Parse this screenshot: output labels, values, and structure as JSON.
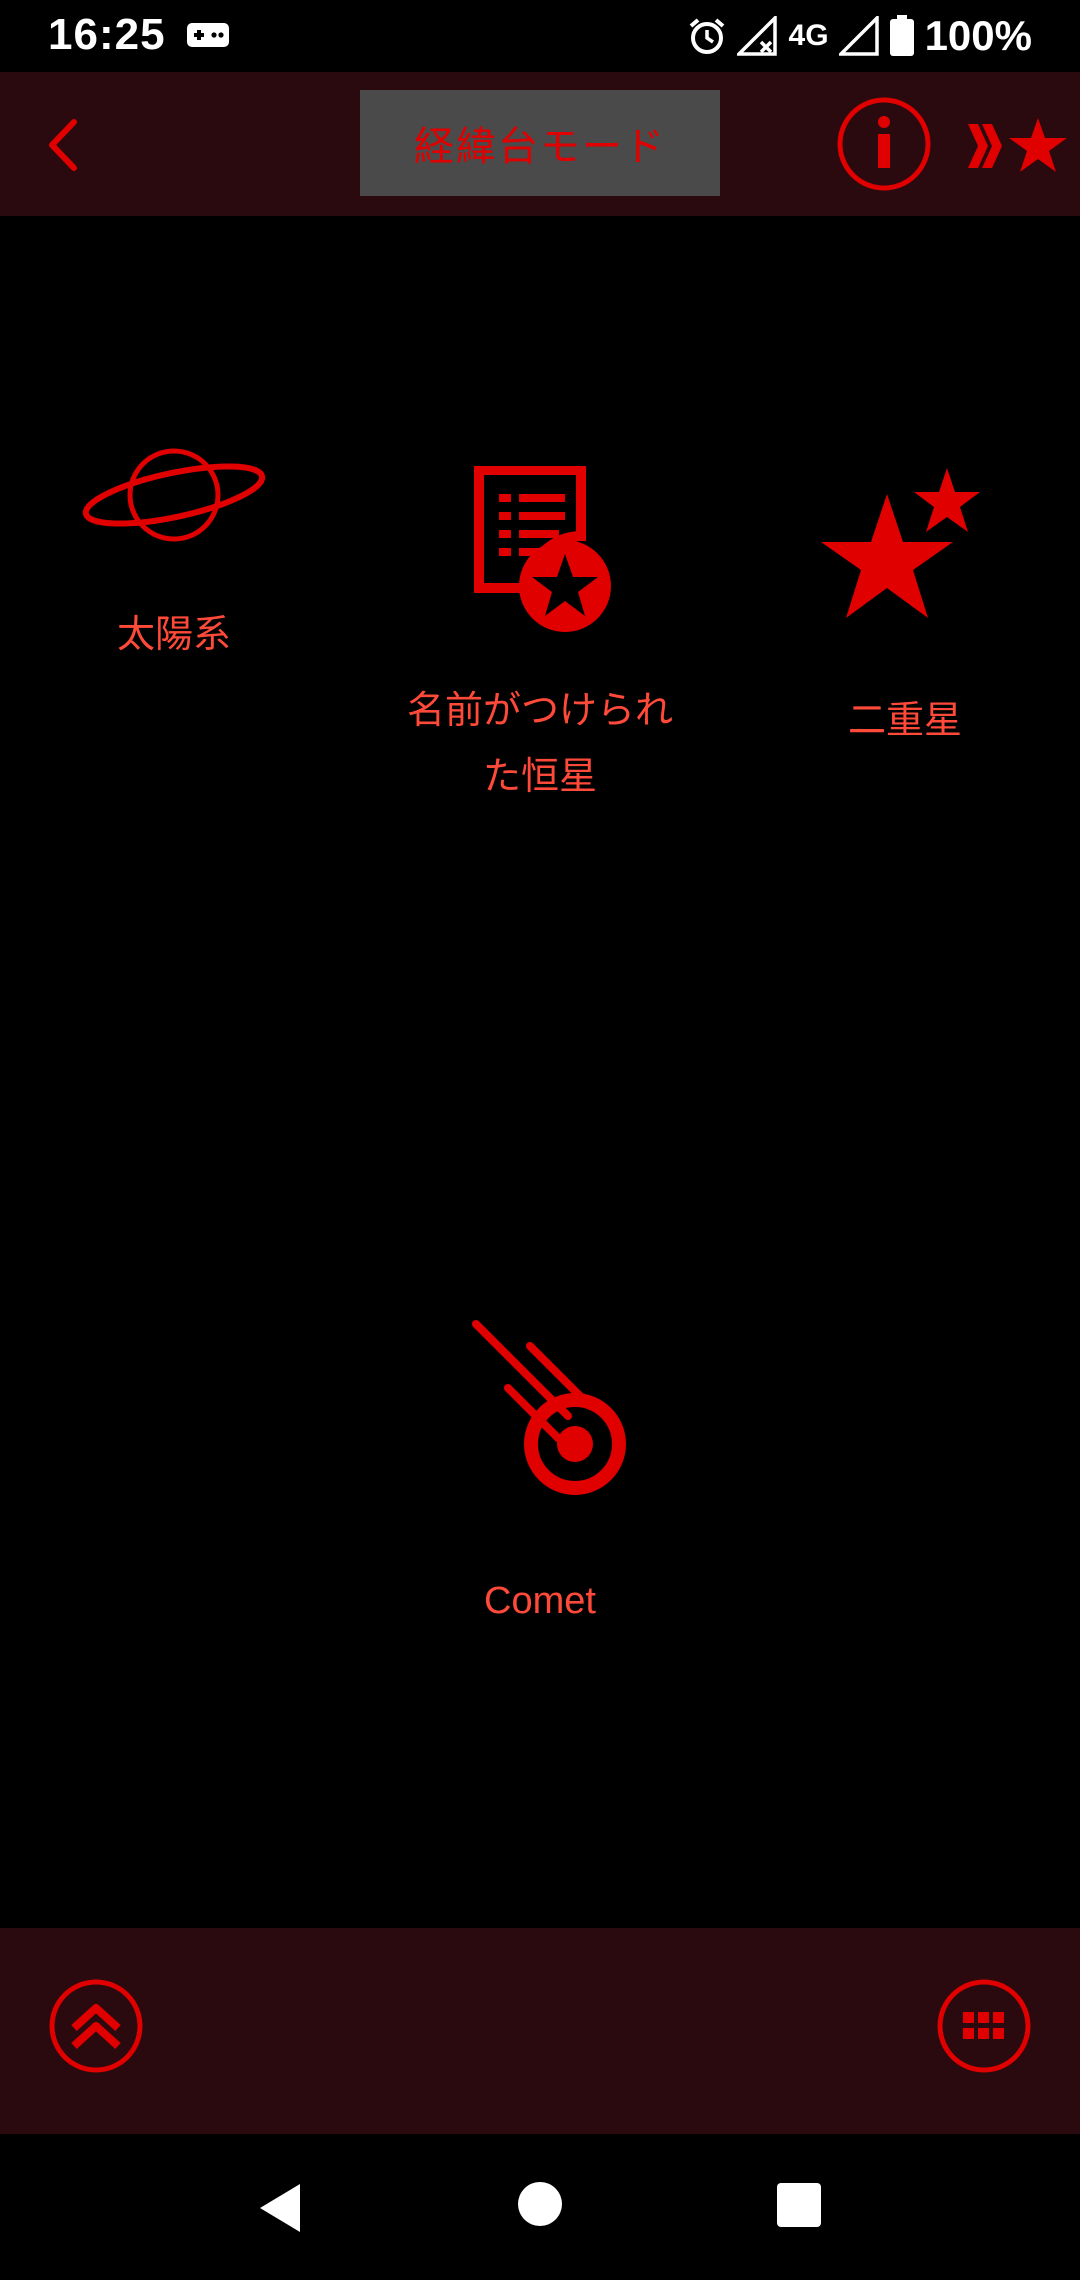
{
  "status_bar": {
    "time": "16:25",
    "network": "4G",
    "battery": "100%",
    "icons": [
      "gamepad-icon",
      "alarm-icon",
      "signal-off-icon",
      "signal-icon",
      "battery-icon"
    ]
  },
  "top_bar": {
    "back_icon": "chevron-left-icon",
    "mode_label": "経緯台モード",
    "info_icon": "info-icon",
    "quick_icon": "fast-forward-star-icon"
  },
  "categories": [
    {
      "id": "solar",
      "label": "太陽系",
      "icon": "planet-icon"
    },
    {
      "id": "named",
      "label_line1": "名前がつけられ",
      "label_line2": "た恒星",
      "icon": "star-catalog-icon"
    },
    {
      "id": "double",
      "label": "二重星",
      "icon": "double-star-icon"
    },
    {
      "id": "comet",
      "label": "Comet",
      "icon": "comet-icon"
    }
  ],
  "bottom_bar": {
    "left_icon": "double-chevron-up-icon",
    "right_icon": "keypad-icon"
  },
  "nav_bar": {
    "icons": [
      "back-triangle-icon",
      "home-circle-icon",
      "recents-square-icon"
    ]
  },
  "colors": {
    "accent_red": "#e00000",
    "label_red": "#ff4a3a",
    "bar_bg": "#2a0a0e",
    "mode_button_bg": "#4a4a4a",
    "background": "#000000"
  }
}
